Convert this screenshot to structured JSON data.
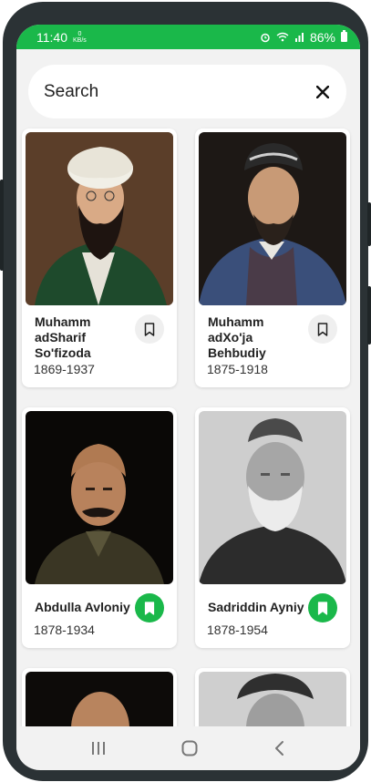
{
  "status_bar": {
    "time": "11:40",
    "net_top": "0",
    "net_unit": "KB/s",
    "battery": "86%"
  },
  "search": {
    "placeholder": "Search"
  },
  "cards": [
    {
      "name": "Muhamm adSharif So'fizoda",
      "years": "1869-1937",
      "bookmarked": false
    },
    {
      "name": "Muhamm adXo'ja Behbudiy",
      "years": "1875-1918",
      "bookmarked": false
    },
    {
      "name": "Abdulla Avloniy",
      "years": "1878-1934",
      "bookmarked": true
    },
    {
      "name": "Sadriddin Ayniy",
      "years": "1878-1954",
      "bookmarked": true
    }
  ],
  "colors": {
    "accent": "#1ab84a",
    "background": "#f2f2f2",
    "card": "#ffffff"
  },
  "icons": [
    "close-icon",
    "bookmark-outline-icon",
    "bookmark-filled-icon",
    "recents-icon",
    "home-icon",
    "back-icon"
  ]
}
